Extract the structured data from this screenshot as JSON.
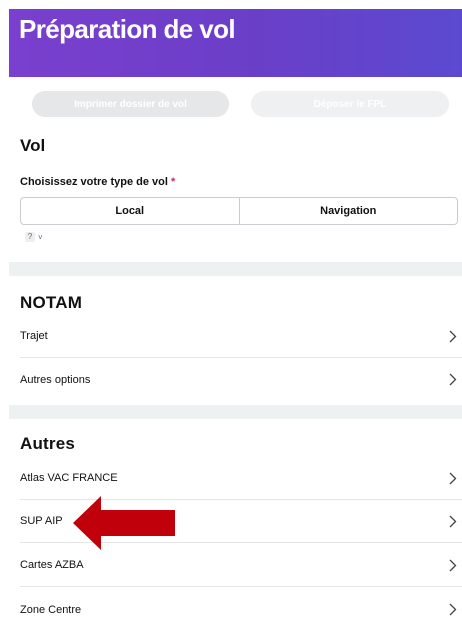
{
  "header": {
    "title": "Préparation de vol"
  },
  "actions": {
    "print_label": "Imprimer dossier de vol",
    "fpl_label": "Déposer le FPL"
  },
  "vol": {
    "title": "Vol",
    "type_label": "Choisissez votre type de vol",
    "required_mark": "*",
    "options": [
      "Local",
      "Navigation"
    ],
    "help_label": "?",
    "help_chevron": "˅"
  },
  "notam": {
    "title": "NOTAM",
    "items": [
      "Trajet",
      "Autres options"
    ]
  },
  "autres": {
    "title": "Autres",
    "items": [
      "Atlas VAC FRANCE",
      "SUP AIP",
      "Cartes AZBA",
      "Zone Centre"
    ]
  },
  "colors": {
    "header_gradient_start": "#7a3fce",
    "header_gradient_end": "#5b4ad0",
    "annotation_arrow": "#c0000a",
    "required": "#d1245a"
  },
  "icons": {
    "row_chevron": "chevron-right-icon",
    "annotation": "red-arrow-annotation"
  }
}
